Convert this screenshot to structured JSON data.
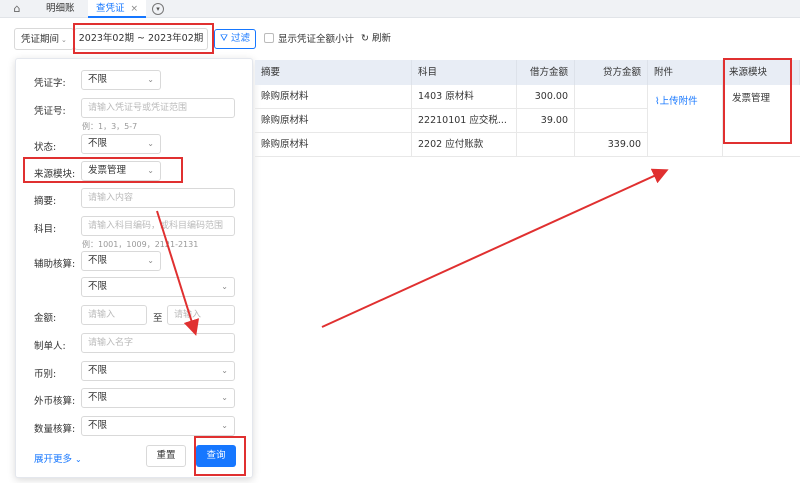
{
  "tabs": [
    {
      "label": "明细账",
      "active": false
    },
    {
      "label": "查凭证",
      "active": true,
      "close": "×"
    }
  ],
  "toolbar": {
    "period_label": "凭证期间",
    "date_range": "2023年02期 ~ 2023年02期",
    "filter_label": "过滤",
    "show_subtotal_label": "显示凭证全额小计",
    "refresh_label": "刷新"
  },
  "filter": {
    "voucher_word": {
      "label": "凭证字:",
      "value": "不限"
    },
    "voucher_no": {
      "label": "凭证号:",
      "placeholder": "请输入凭证号或凭证范围",
      "hint": "例：1，3，5-7"
    },
    "status": {
      "label": "状态:",
      "value": "不限"
    },
    "source_module": {
      "label": "来源模块:",
      "value": "发票管理"
    },
    "summary": {
      "label": "摘要:",
      "placeholder": "请输入内容"
    },
    "subject": {
      "label": "科目:",
      "placeholder": "请输入科目编码，或科目编码范围",
      "hint": "例：1001，1009，2121-2131"
    },
    "aux": {
      "label": "辅助核算:",
      "value1": "不限",
      "value2": "不限"
    },
    "amount": {
      "label": "金额:",
      "placeholder_from": "请输入",
      "to": "至",
      "placeholder_to": "请输入"
    },
    "creator": {
      "label": "制单人:",
      "placeholder": "请输入名字"
    },
    "currency": {
      "label": "币别:",
      "value": "不限"
    },
    "foreign": {
      "label": "外币核算:",
      "value": "不限"
    },
    "quantity": {
      "label": "数量核算:",
      "value": "不限"
    },
    "expand_more": "展开更多",
    "reset": "重置",
    "query": "查询"
  },
  "table": {
    "headers": [
      "摘要",
      "科目",
      "借方金额",
      "贷方金额",
      "附件",
      "来源模块"
    ],
    "rows": [
      {
        "summary": "赊购原材料",
        "subject": "1403 原材料",
        "debit": "300.00",
        "credit": ""
      },
      {
        "summary": "赊购原材料",
        "subject": "22210101 应交税...",
        "debit": "39.00",
        "credit": ""
      },
      {
        "summary": "赊购原材料",
        "subject": "2202 应付账款",
        "debit": "",
        "credit": "339.00"
      }
    ],
    "attachment_link": "上传附件",
    "source_module": "发票管理"
  }
}
